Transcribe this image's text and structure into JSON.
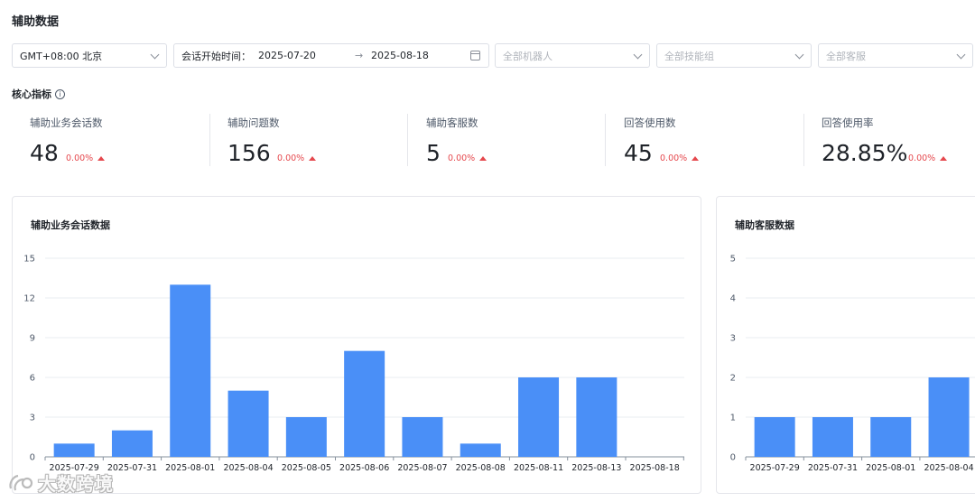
{
  "page": {
    "title": "辅助数据"
  },
  "filters": {
    "timezone": "GMT+08:00 北京",
    "date_label": "会话开始时间：",
    "date_start": "2025-07-20",
    "date_arrow": "→",
    "date_end": "2025-08-18",
    "robot_placeholder": "全部机器人",
    "skill_group_placeholder": "全部技能组",
    "agent_placeholder": "全部客服"
  },
  "core_metrics": {
    "title": "核心指标",
    "info_icon": "i",
    "items": [
      {
        "label": "辅助业务会话数",
        "value": "48",
        "delta": "0.00%"
      },
      {
        "label": "辅助问题数",
        "value": "156",
        "delta": "0.00%"
      },
      {
        "label": "辅助客服数",
        "value": "5",
        "delta": "0.00%"
      },
      {
        "label": "回答使用数",
        "value": "45",
        "delta": "0.00%"
      },
      {
        "label": "回答使用率",
        "value": "28.85%",
        "delta": "0.00%"
      }
    ],
    "delta_color": "#e5484d"
  },
  "chart_data": [
    {
      "type": "bar",
      "title": "辅助业务会话数据",
      "categories": [
        "2025-07-29",
        "2025-07-31",
        "2025-08-01",
        "2025-08-04",
        "2025-08-05",
        "2025-08-06",
        "2025-08-07",
        "2025-08-08",
        "2025-08-11",
        "2025-08-13",
        "2025-08-18"
      ],
      "values": [
        1,
        2,
        13,
        5,
        3,
        8,
        3,
        1,
        6,
        6,
        0
      ],
      "yticks": [
        "0",
        "3",
        "6",
        "9",
        "12",
        "15"
      ],
      "ylim": [
        0,
        15
      ],
      "grid": true,
      "bar_color": "#4a8ff7"
    },
    {
      "type": "bar",
      "title": "辅助客服数据",
      "categories": [
        "2025-07-29",
        "2025-07-31",
        "2025-08-01",
        "2025-08-04"
      ],
      "values": [
        1,
        1,
        1,
        2
      ],
      "yticks": [
        "0",
        "1",
        "2",
        "3",
        "4",
        "5"
      ],
      "ylim": [
        0,
        5
      ],
      "grid": true,
      "bar_color": "#4a8ff7"
    }
  ],
  "watermark": {
    "text": "大数跨境"
  }
}
